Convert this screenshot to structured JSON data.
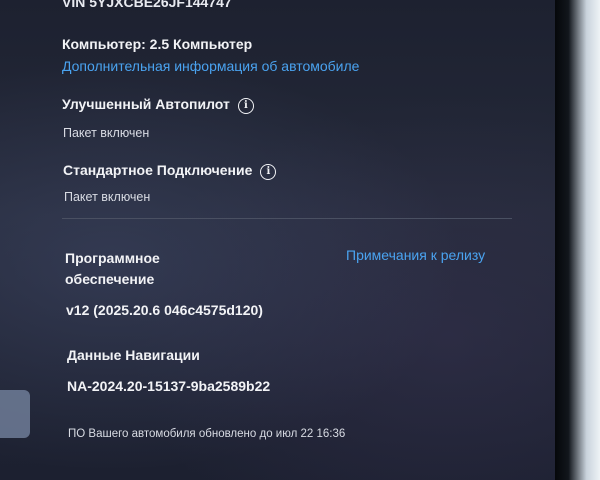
{
  "vehicle": {
    "vin_label": "VIN 5YJXCBE26JF144747",
    "computer": "Компьютер: 2.5 Компьютер",
    "more_info_link": "Дополнительная информация об автомобиле"
  },
  "packages": [
    {
      "title": "Улучшенный Автопилот",
      "status": "Пакет включен",
      "icon": "info-icon"
    },
    {
      "title": "Стандартное Подключение",
      "status": "Пакет включен",
      "icon": "info-icon"
    }
  ],
  "software": {
    "title": "Программное обеспечение",
    "release_notes_link": "Примечания к релизу",
    "version": "v12 (2025.20.6 046c4575d120)"
  },
  "navigation": {
    "title": "Данные Навигации",
    "version": "NA-2024.20-15137-9ba2589b22"
  },
  "footer": {
    "updated_text": "ПО Вашего автомобиля обновлено до июл 22 16:36"
  },
  "colors": {
    "link": "#4aa3f0",
    "background": "#1f2333",
    "text": "#f2f3f6"
  }
}
